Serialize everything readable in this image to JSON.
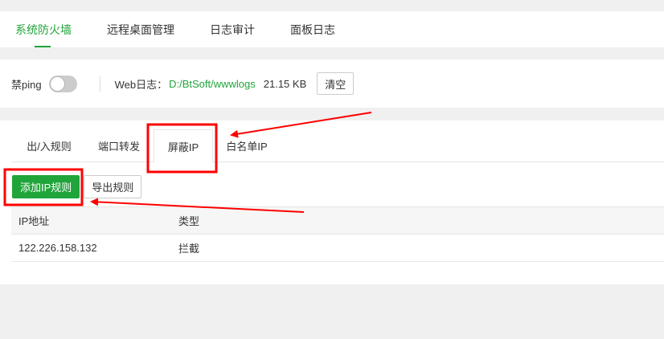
{
  "topnav": {
    "items": [
      {
        "label": "系统防火墙",
        "active": true
      },
      {
        "label": "远程桌面管理",
        "active": false
      },
      {
        "label": "日志审计",
        "active": false
      },
      {
        "label": "面板日志",
        "active": false
      }
    ]
  },
  "settings": {
    "ping_label": "禁ping",
    "ping_enabled": false,
    "weblog_label": "Web日志：",
    "weblog_path": "D:/BtSoft/wwwlogs",
    "weblog_size": "21.15 KB",
    "clear_label": "清空"
  },
  "tabs": [
    {
      "label": "出/入规则",
      "active": false
    },
    {
      "label": "端口转发",
      "active": false
    },
    {
      "label": "屏蔽IP",
      "active": true
    },
    {
      "label": "白名单IP",
      "active": false
    }
  ],
  "actions": {
    "add_label": "添加IP规则",
    "export_label": "导出规则"
  },
  "table": {
    "headers": [
      "IP地址",
      "类型"
    ],
    "rows": [
      [
        "122.226.158.132",
        "拦截"
      ]
    ]
  },
  "colors": {
    "accent": "#20a53a",
    "annotation": "#ff0000"
  }
}
